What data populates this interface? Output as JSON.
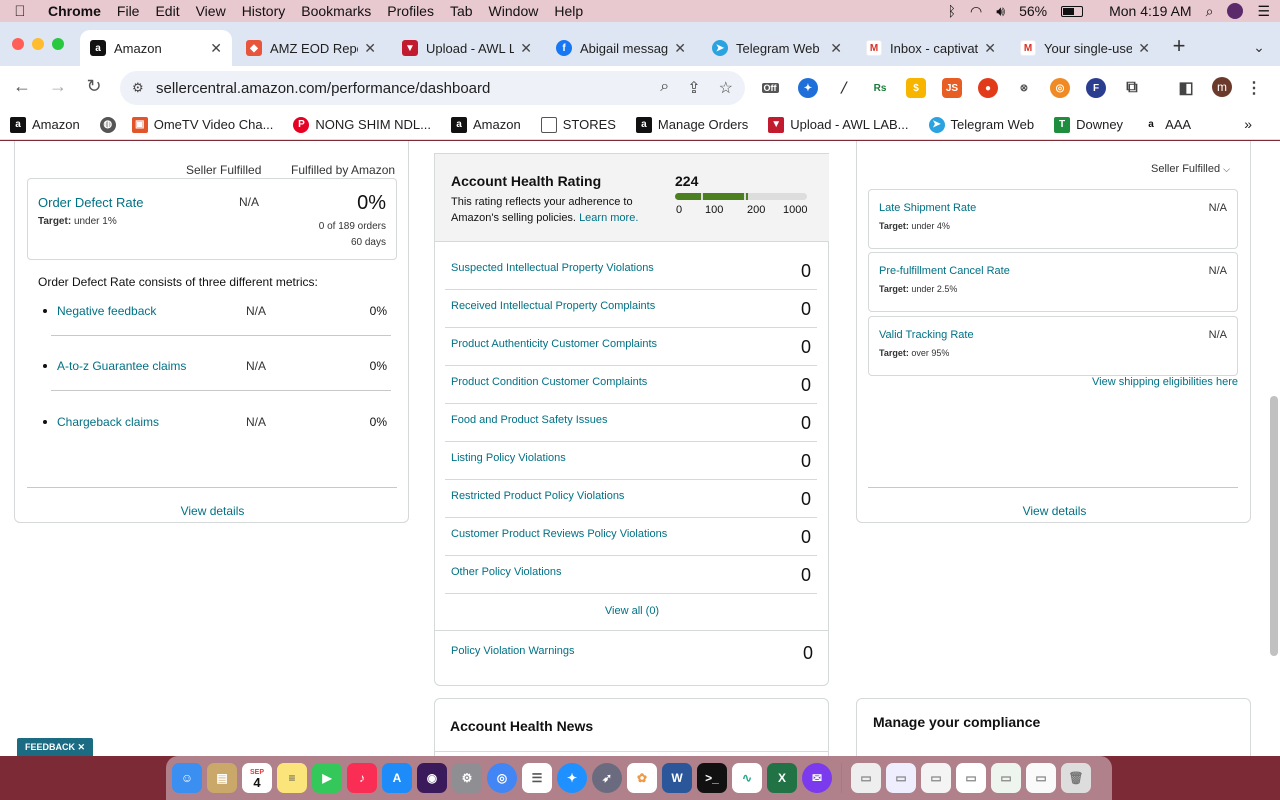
{
  "menubar": {
    "app": "Chrome",
    "items": [
      "File",
      "Edit",
      "View",
      "History",
      "Bookmarks",
      "Profiles",
      "Tab",
      "Window",
      "Help"
    ],
    "battery": "56%",
    "clock": "Mon 4:19 AM"
  },
  "tabs": [
    {
      "title": "Amazon",
      "close": "✕"
    },
    {
      "title": "AMZ EOD Repo",
      "close": "✕"
    },
    {
      "title": "Upload - AWL L",
      "close": "✕"
    },
    {
      "title": "Abigail messag",
      "close": "✕"
    },
    {
      "title": "Telegram Web",
      "close": "✕"
    },
    {
      "title": "Inbox - captivat",
      "close": "✕"
    },
    {
      "title": "Your single-use",
      "close": "✕"
    }
  ],
  "newtab": "+",
  "address": {
    "url": "sellercentral.amazon.com/performance/dashboard"
  },
  "extensions": {
    "off_badge": "Off",
    "avatar": "m"
  },
  "bookmarks": [
    {
      "label": "Amazon"
    },
    {
      "label": ""
    },
    {
      "label": "OmeTV Video Cha..."
    },
    {
      "label": "NONG SHIM NDL..."
    },
    {
      "label": "Amazon"
    },
    {
      "label": "STORES"
    },
    {
      "label": "Manage Orders"
    },
    {
      "label": "Upload - AWL LAB..."
    },
    {
      "label": "Telegram Web"
    },
    {
      "label": "Downey"
    },
    {
      "label": "AAA"
    }
  ],
  "left_card": {
    "col_seller": "Seller Fulfilled",
    "col_fba": "Fulfilled by Amazon",
    "odr": {
      "title": "Order Defect Rate",
      "target_label": "Target:",
      "target_value": "under 1%",
      "seller_value": "N/A",
      "fba_value": "0%",
      "orders": "0 of 189 orders",
      "days": "60 days"
    },
    "desc": "Order Defect Rate consists of three different metrics:",
    "metrics": [
      {
        "label": "Negative feedback",
        "seller": "N/A",
        "fba": "0%"
      },
      {
        "label": "A-to-z Guarantee claims",
        "seller": "N/A",
        "fba": "0%"
      },
      {
        "label": "Chargeback claims",
        "seller": "N/A",
        "fba": "0%"
      }
    ],
    "view_details": "View details"
  },
  "middle_card": {
    "title": "Account Health Rating",
    "desc": "This rating reflects your adherence to Amazon's selling policies.",
    "learn_more": "Learn more.",
    "score": "224",
    "ticks": [
      "0",
      "100",
      "200",
      "1000"
    ],
    "violations": [
      {
        "label": "Suspected Intellectual Property Violations",
        "count": "0"
      },
      {
        "label": "Received Intellectual Property Complaints",
        "count": "0"
      },
      {
        "label": "Product Authenticity Customer Complaints",
        "count": "0"
      },
      {
        "label": "Product Condition Customer Complaints",
        "count": "0"
      },
      {
        "label": "Food and Product Safety Issues",
        "count": "0"
      },
      {
        "label": "Listing Policy Violations",
        "count": "0"
      },
      {
        "label": "Restricted Product Policy Violations",
        "count": "0"
      },
      {
        "label": "Customer Product Reviews Policy Violations",
        "count": "0"
      },
      {
        "label": "Other Policy Violations",
        "count": "0"
      }
    ],
    "view_all": "View all (0)",
    "warnings": {
      "label": "Policy Violation Warnings",
      "count": "0"
    }
  },
  "right_card": {
    "dropdown": "Seller Fulfilled",
    "metrics": [
      {
        "title": "Late Shipment Rate",
        "target_label": "Target:",
        "target_value": "under 4%",
        "value": "N/A"
      },
      {
        "title": "Pre-fulfillment Cancel Rate",
        "target_label": "Target:",
        "target_value": "under 2.5%",
        "value": "N/A"
      },
      {
        "title": "Valid Tracking Rate",
        "target_label": "Target:",
        "target_value": "over 95%",
        "value": "N/A"
      }
    ],
    "ship_link": "View shipping eligibilities here",
    "view_details": "View details"
  },
  "news": {
    "title": "Account Health News"
  },
  "compliance": {
    "title": "Manage your compliance"
  },
  "feedback": "FEEDBACK",
  "feedback_close": "✕",
  "dock": {
    "calendar_month": "SEP",
    "calendar_day": "4"
  }
}
